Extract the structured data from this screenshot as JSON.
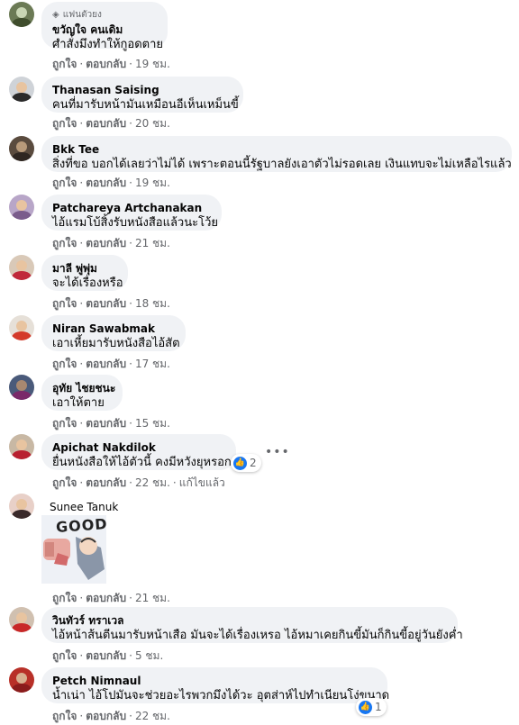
{
  "comments": [
    {
      "badge": "แฟนตัวยง",
      "name": "ขวัญใจ คนเดิม",
      "text": "ศำสั่งมึงทำให้กูอดตาย",
      "action_like": "ถูกใจ",
      "action_reply": "ตอบกลับ",
      "time": "19 ชม."
    },
    {
      "name": "Thanasan Saising",
      "text": "คนที่มารับหน้ามันเหมือนอีเห็นเหม็นขี้",
      "action_like": "ถูกใจ",
      "action_reply": "ตอบกลับ",
      "time": "20 ชม."
    },
    {
      "name": "Bkk Tee",
      "text": "สิ่งที่ขอ บอกได้เลยว่าไม่ได้ เพราะตอนนี้รัฐบาลยังเอาตัวไม่รอดเลย เงินแทบจะไม่เหลือไรแล้ว",
      "action_like": "ถูกใจ",
      "action_reply": "ตอบกลับ",
      "time": "19 ชม."
    },
    {
      "name": "Patchareya Artchanakan",
      "text": "ไอ้แรมโบ้สิ้งรับหนังสือแล้วนะโว้ย",
      "action_like": "ถูกใจ",
      "action_reply": "ตอบกลับ",
      "time": "21 ชม."
    },
    {
      "name": "มาลี พู่พุ่ม",
      "text": "จะได้เรื่องหรือ",
      "action_like": "ถูกใจ",
      "action_reply": "ตอบกลับ",
      "time": "18 ชม."
    },
    {
      "name": "Niran Sawabmak",
      "text": "เอาเหี้ยมารับหนังสือไอ้สัต",
      "action_like": "ถูกใจ",
      "action_reply": "ตอบกลับ",
      "time": "17 ชม."
    },
    {
      "name": "อุทัย ไชยชนะ",
      "text": "เอาให้ตาย",
      "action_like": "ถูกใจ",
      "action_reply": "ตอบกลับ",
      "time": "15 ชม."
    },
    {
      "name": "Apichat Nakdilok",
      "text": "ยื่นหนังสือให้ไอ้ตัวนี้ คงมีหวังยุหรอก",
      "action_like": "ถูกใจ",
      "action_reply": "ตอบกลับ",
      "time": "22 ชม.",
      "edited": "แก้ไขแล้ว",
      "reactions": "2"
    },
    {
      "name": "Sunee Tanuk",
      "sticker_text": "GOOD",
      "action_like": "ถูกใจ",
      "action_reply": "ตอบกลับ",
      "time": "21 ชม."
    },
    {
      "name": "วินทัวร์ ทราเวล",
      "text": "ไอ้หน้าส้นตีนมารับหน้าเสือ มันจะได้เรื่องเหรอ ไอ้หมาเคยกินขี้มันก็กินขี้อยู่วันยังค่ำ",
      "action_like": "ถูกใจ",
      "action_reply": "ตอบกลับ",
      "time": "5 ชม."
    },
    {
      "name": "Petch Nimnaul",
      "text": "น้ำเน่า ไอ้โปมันจะช่วยอะไรพวกมึงได้วะ อุตส่าห์ไปทำเนียนโง่ขนาด",
      "action_like": "ถูกใจ",
      "action_reply": "ตอบกลับ",
      "time": "22 ชม.",
      "reactions": "1"
    }
  ],
  "colors": {
    "bubble": "#f0f2f5",
    "meta": "#65676b",
    "like_blue": "#1877f2"
  }
}
